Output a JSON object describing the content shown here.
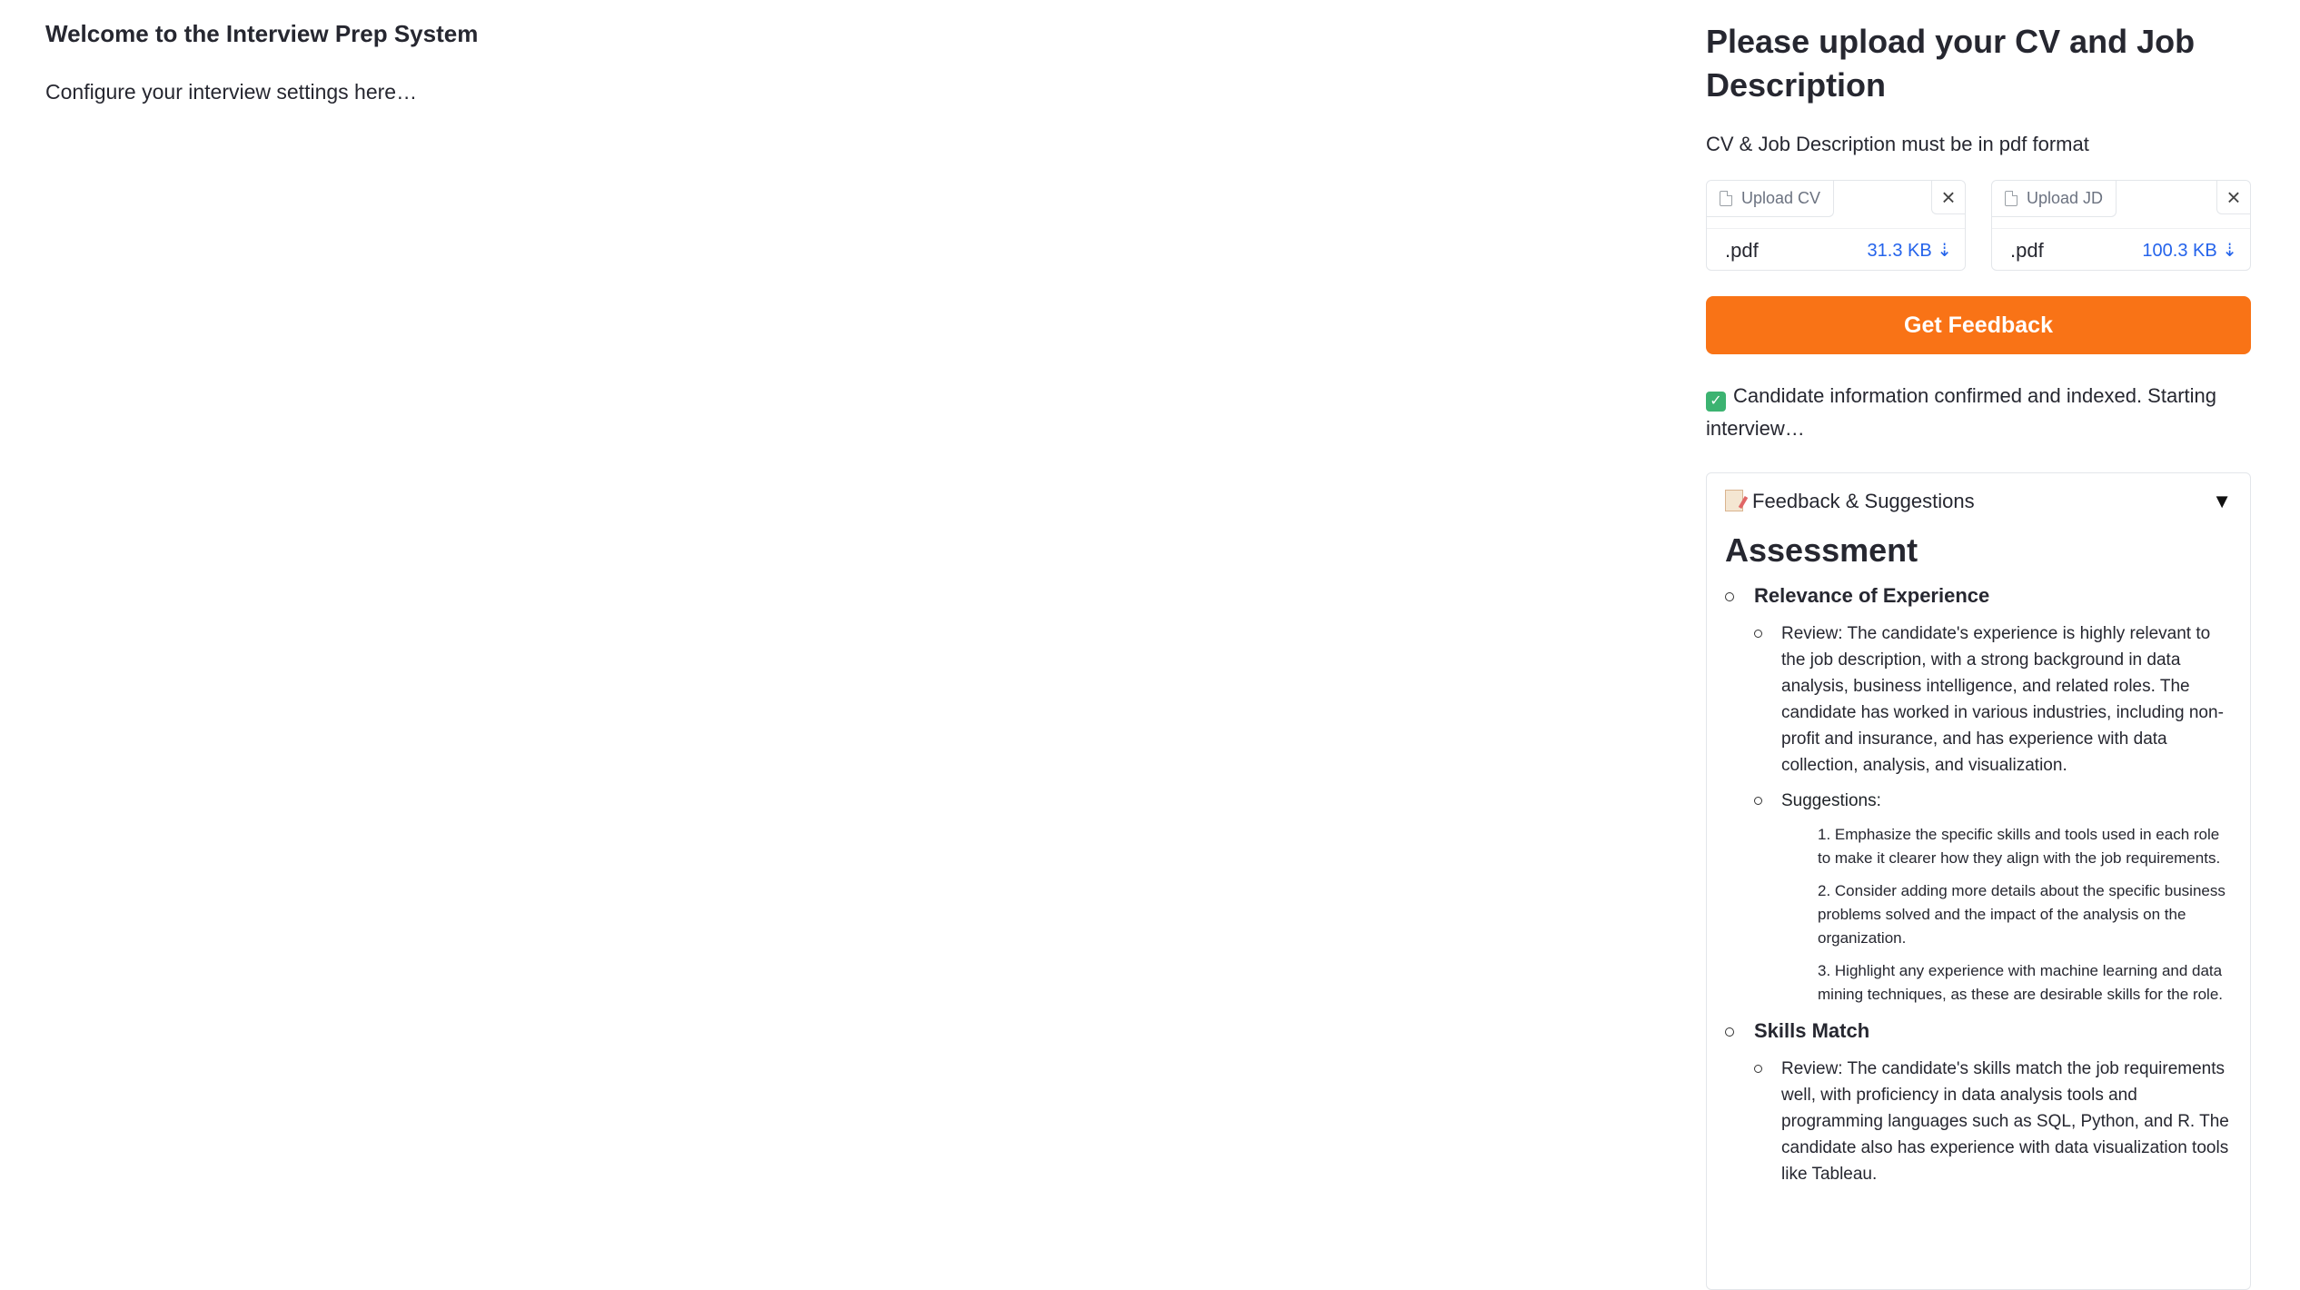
{
  "left": {
    "title": "Welcome to the Interview Prep System",
    "subtitle": "Configure your interview settings here…"
  },
  "panel": {
    "title": "Please upload your CV and Job Description",
    "note": "CV & Job Description must be in pdf format",
    "uploads": [
      {
        "label": "Upload CV",
        "file": ".pdf",
        "size": "31.3 KB ⇣"
      },
      {
        "label": "Upload JD",
        "file": ".pdf",
        "size": "100.3 KB ⇣"
      }
    ],
    "feedback_button": "Get Feedback",
    "status": "Candidate information confirmed and indexed. Starting interview…",
    "accordion": {
      "label": "Feedback & Suggestions",
      "caret": "▼",
      "heading": "Assessment",
      "sections": [
        {
          "title": "Relevance of Experience",
          "review": "Review: The candidate's experience is highly relevant to the job description, with a strong background in data analysis, business intelligence, and related roles. The candidate has worked in various industries, including non-profit and insurance, and has experience with data collection, analysis, and visualization.",
          "suggestions_label": "Suggestions:",
          "suggestions": [
            "1. Emphasize the specific skills and tools used in each role to make it clearer how they align with the job requirements.",
            "2. Consider adding more details about the specific business problems solved and the impact of the analysis on the organization.",
            "3. Highlight any experience with machine learning and data mining techniques, as these are desirable skills for the role."
          ]
        },
        {
          "title": "Skills Match",
          "review": "Review: The candidate's skills match the job requirements well, with proficiency in data analysis tools and programming languages such as SQL, Python, and R. The candidate also has experience with data visualization tools like Tableau."
        }
      ]
    }
  },
  "colors": {
    "accent": "#f97316",
    "link": "#2463eb"
  }
}
